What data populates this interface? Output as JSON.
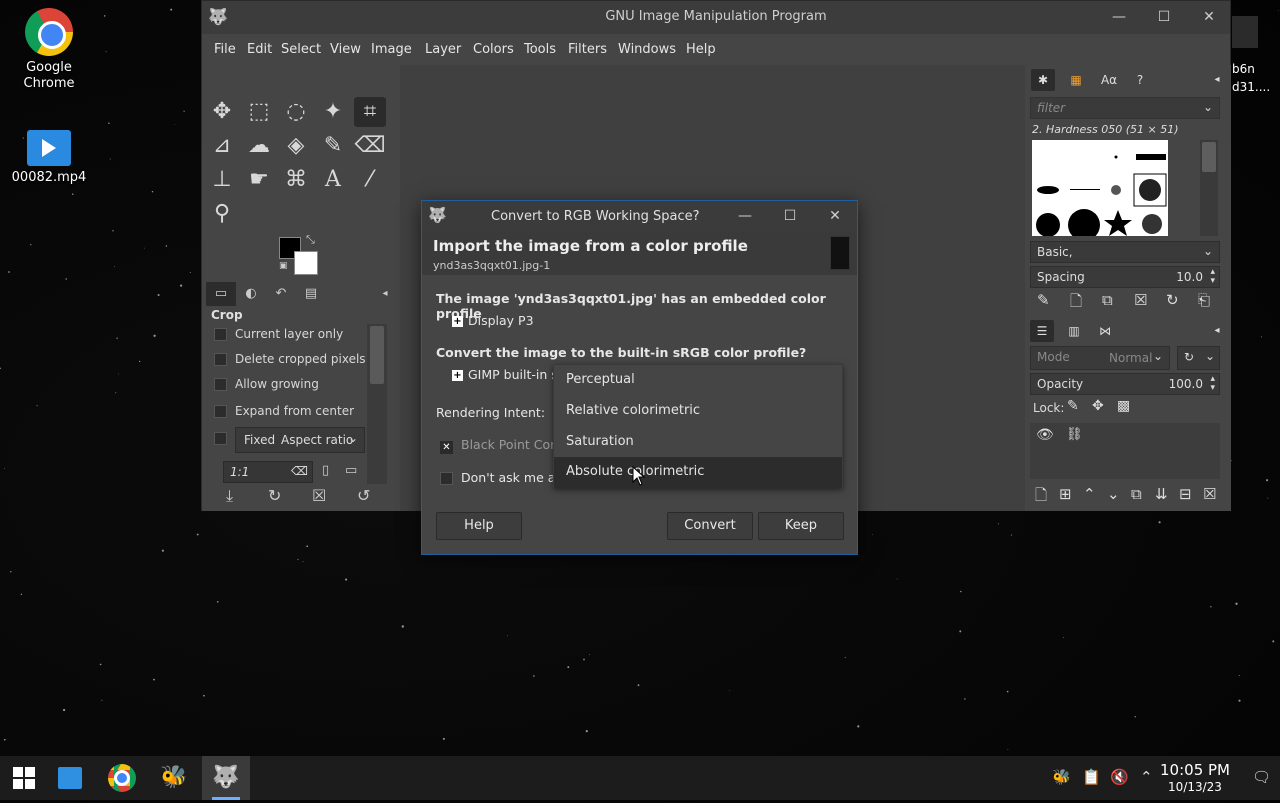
{
  "desktop": {
    "icons": [
      {
        "label": "Google Chrome"
      },
      {
        "label": "00082.mp4"
      }
    ],
    "partial_labels": [
      "b6n",
      "d31...."
    ]
  },
  "gimp": {
    "title": "GNU Image Manipulation Program",
    "menu": [
      "File",
      "Edit",
      "Select",
      "View",
      "Image",
      "Layer",
      "Colors",
      "Tools",
      "Filters",
      "Windows",
      "Help"
    ],
    "tool_options": {
      "title": "Crop",
      "options": [
        "Current layer only",
        "Delete cropped pixels",
        "Allow growing",
        "Expand from center"
      ],
      "fixed_label": "Fixed",
      "fixed_value": "Aspect ratio",
      "ratio_value": "1:1"
    },
    "brushes": {
      "filter_placeholder": "filter",
      "brush_name": "2. Hardness 050 (51 × 51)",
      "preset": "Basic,",
      "spacing_label": "Spacing",
      "spacing_value": "10.0"
    },
    "layers": {
      "mode_label": "Mode",
      "mode_value": "Normal",
      "opacity_label": "Opacity",
      "opacity_value": "100.0",
      "lock_label": "Lock:"
    }
  },
  "dialog": {
    "title": "Convert to RGB Working Space?",
    "heading": "Import the image from a color profile",
    "subheading": "ynd3as3qqxt01.jpg-1",
    "embedded_text": "The image 'ynd3as3qqxt01.jpg' has an embedded color profile",
    "embedded_profile": "Display P3",
    "convert_text": "Convert the image to the built-in sRGB color profile?",
    "builtin_profile": "GIMP built-in s",
    "rendering_intent_label": "Rendering Intent:",
    "black_point_label": "Black Point Con",
    "dont_ask_label": "Don't ask me a",
    "buttons": {
      "help": "Help",
      "convert": "Convert",
      "keep": "Keep"
    },
    "intent_options": [
      "Perceptual",
      "Relative colorimetric",
      "Saturation",
      "Absolute colorimetric"
    ],
    "intent_selected": "Absolute colorimetric"
  },
  "taskbar": {
    "time": "10:05 PM",
    "date": "10/13/23"
  },
  "colors": {
    "accent": "#1f5f9e",
    "panel": "#454545",
    "taskbar": "#1c1c1c"
  }
}
